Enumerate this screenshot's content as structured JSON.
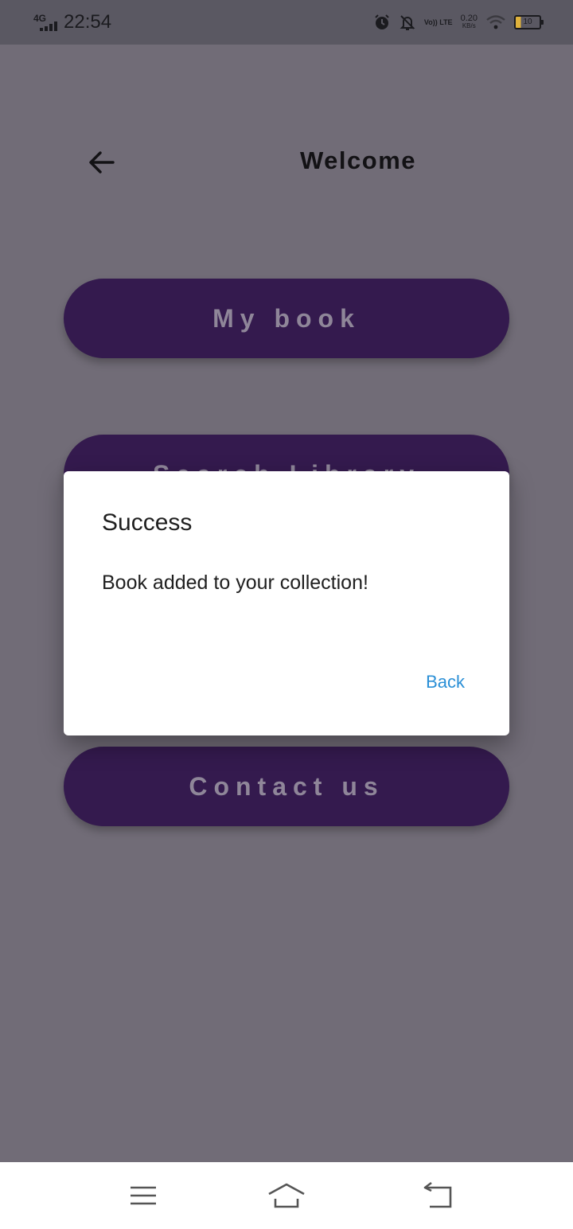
{
  "status_bar": {
    "network": "4G",
    "time": "22:54",
    "volte": "Vo)) LTE",
    "speed_value": "0.20",
    "speed_unit": "KB/s",
    "battery": "10",
    "icons": [
      "signal-icon",
      "alarm-icon",
      "bell-off-icon",
      "wifi-icon",
      "battery-icon"
    ]
  },
  "header": {
    "title": "Welcome",
    "back_icon": "back-arrow-icon"
  },
  "menu": {
    "items": [
      {
        "label": "My book"
      },
      {
        "label": "Search Library"
      },
      {
        "label": "Contact us"
      }
    ]
  },
  "dialog": {
    "title": "Success",
    "message": "Book added to your collection!",
    "action": "Back"
  },
  "nav_bar": {
    "icons": [
      "menu-icon",
      "home-icon",
      "back-icon"
    ]
  },
  "colors": {
    "button_bg": "#341a4e",
    "scrim_bg": "#716c77",
    "dialog_action": "#2a8fd6",
    "status_bar_bg": "#5a5862"
  }
}
